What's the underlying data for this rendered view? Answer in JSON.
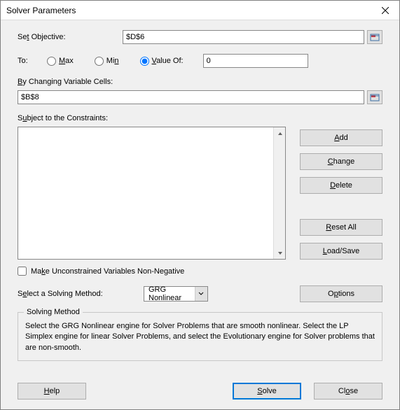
{
  "window": {
    "title": "Solver Parameters"
  },
  "objective": {
    "label_prefix": "Se",
    "label_u": "t",
    "label_suffix": " Objective:",
    "value": "$D$6"
  },
  "to": {
    "label": "To:",
    "max_u": "M",
    "max_suffix": "ax",
    "min_prefix": "Mi",
    "min_u": "n",
    "value_u": "V",
    "value_suffix": "alue Of:",
    "value_input": "0",
    "selected": "value"
  },
  "changing": {
    "label_u": "B",
    "label_suffix": "y Changing Variable Cells:",
    "value": "$B$8"
  },
  "constraints": {
    "label_prefix": "S",
    "label_u": "u",
    "label_suffix": "bject to the Constraints:"
  },
  "buttons": {
    "add_u": "A",
    "add_suffix": "dd",
    "change_u": "C",
    "change_suffix": "hange",
    "delete_u": "D",
    "delete_suffix": "elete",
    "reset_u": "R",
    "reset_suffix": "eset All",
    "load_u": "L",
    "load_suffix": "oad/Save",
    "options_prefix": "O",
    "options_u": "p",
    "options_suffix": "tions",
    "help_u": "H",
    "help_suffix": "elp",
    "solve_u": "S",
    "solve_suffix": "olve",
    "close_prefix": "Cl",
    "close_u": "o",
    "close_suffix": "se"
  },
  "make_unconstrained": {
    "prefix": "Ma",
    "u": "k",
    "suffix": "e Unconstrained Variables Non-Negative",
    "checked": false
  },
  "method": {
    "label_prefix": "S",
    "label_u": "e",
    "label_suffix": "lect a Solving Method:",
    "selected": "GRG Nonlinear"
  },
  "info": {
    "heading": "Solving Method",
    "text": "Select the GRG Nonlinear engine for Solver Problems that are smooth nonlinear. Select the LP Simplex engine for linear Solver Problems, and select the Evolutionary engine for Solver problems that are non-smooth."
  }
}
